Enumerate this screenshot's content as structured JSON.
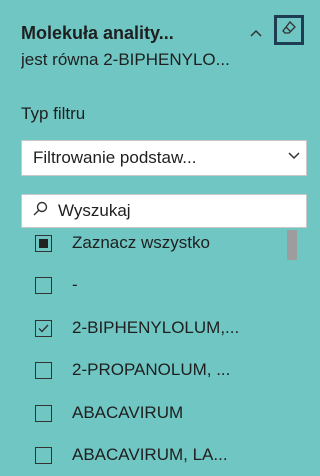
{
  "slicer": {
    "title": "Molekuła anality...",
    "subtitle": "jest równa 2-BIPHENYLO...",
    "filter_type_label": "Typ filtru",
    "filter_type_value": "Filtrowanie podstaw...",
    "search_placeholder": "Wyszukaj",
    "items": [
      {
        "label": "Zaznacz wszystko",
        "state": "partial"
      },
      {
        "label": "-",
        "state": "unchecked"
      },
      {
        "label": "2-BIPHENYLOLUM,...",
        "state": "checked"
      },
      {
        "label": "2-PROPANOLUM, ...",
        "state": "unchecked"
      },
      {
        "label": "ABACAVIRUM",
        "state": "unchecked"
      },
      {
        "label": "ABACAVIRUM, LA...",
        "state": "unchecked"
      }
    ]
  },
  "icons": {
    "collapse": "chevron-up-icon",
    "clear": "eraser-icon",
    "dropdown": "chevron-down-icon",
    "search": "search-icon"
  },
  "colors": {
    "background": "#6fc6c3",
    "focus_border": "#1f3d52"
  }
}
